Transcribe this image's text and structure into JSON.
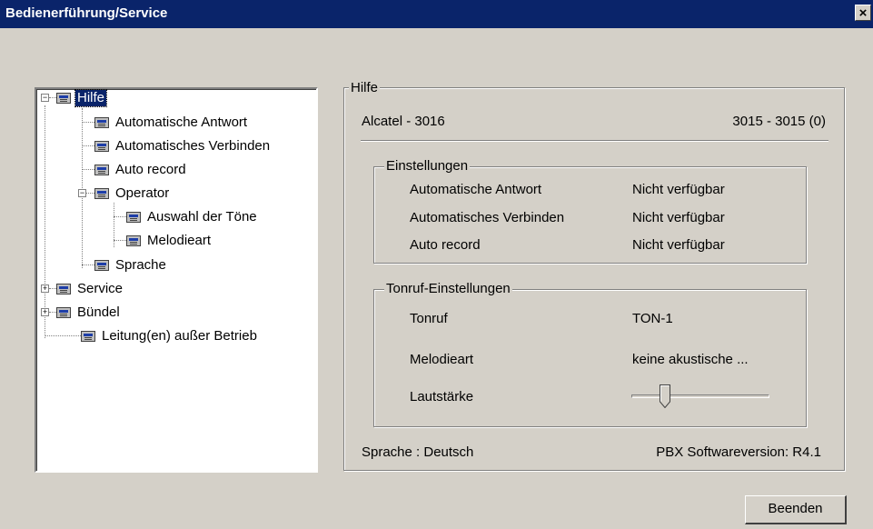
{
  "window": {
    "title": "Bedienerführung/Service",
    "close_label": "×"
  },
  "tree": {
    "items": [
      {
        "label": "Hilfe",
        "expander": "−"
      },
      {
        "label": "Automatische Antwort"
      },
      {
        "label": "Automatisches Verbinden"
      },
      {
        "label": "Auto record"
      },
      {
        "label": "Operator",
        "expander": "−"
      },
      {
        "label": "Auswahl der Töne"
      },
      {
        "label": "Melodieart"
      },
      {
        "label": "Sprache"
      },
      {
        "label": "Service",
        "expander": "+"
      },
      {
        "label": "Bündel",
        "expander": "+"
      },
      {
        "label": "Leitung(en) außer Betrieb"
      }
    ]
  },
  "panel": {
    "title": "Hilfe",
    "device": "Alcatel - 3016",
    "extension": "3015 - 3015 (0)",
    "settings": {
      "title": "Einstellungen",
      "rows": [
        {
          "label": "Automatische Antwort",
          "value": "Nicht verfügbar"
        },
        {
          "label": "Automatisches Verbinden",
          "value": "Nicht verfügbar"
        },
        {
          "label": "Auto record",
          "value": "Nicht verfügbar"
        }
      ]
    },
    "ring": {
      "title": "Tonruf-Einstellungen",
      "tonruf_label": "Tonruf",
      "tonruf_value": "TON-1",
      "melodie_label": "Melodieart",
      "melodie_value": "keine akustische ...",
      "volume_label": "Lautstärke",
      "volume_level": 0.22
    },
    "language": "Sprache : Deutsch",
    "version": "PBX Softwareversion: R4.1"
  },
  "buttons": {
    "close_label": "Beenden"
  },
  "colors": {
    "titlebar": "#0a246a",
    "face": "#d4d0c8",
    "selection": "#0a246a"
  }
}
